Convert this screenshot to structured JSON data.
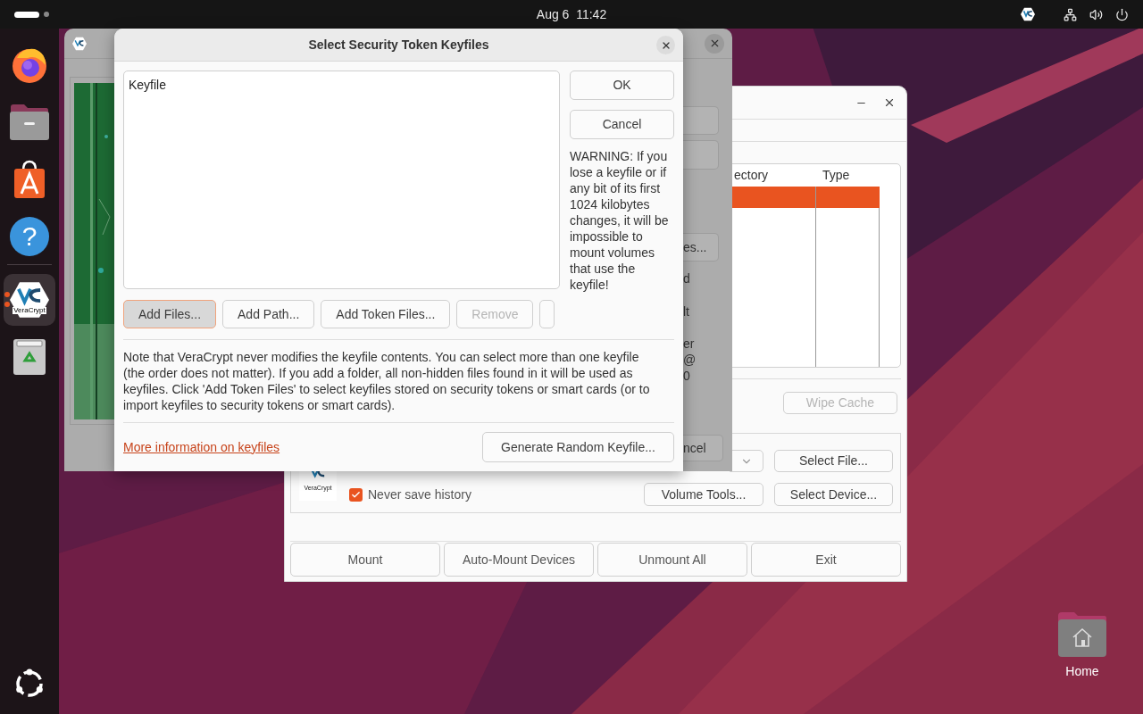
{
  "top_bar": {
    "clock": "Aug 6  11:42"
  },
  "dock": {
    "items": [
      {
        "kind": "firefox",
        "running": false
      },
      {
        "kind": "files",
        "running": false
      },
      {
        "kind": "appcenter",
        "running": false
      },
      {
        "kind": "help",
        "running": false,
        "glyph": "?"
      },
      {
        "kind": "veracrypt",
        "running": true,
        "logo_text": "VeraCrypt"
      },
      {
        "kind": "trash",
        "running": false
      }
    ]
  },
  "desktop_icons": [
    {
      "label": "Home"
    }
  ],
  "main_window": {
    "table": {
      "columns": [
        "ectory",
        "Type"
      ],
      "rows": [
        {
          "selected": true
        }
      ]
    },
    "wipe_cache": {
      "label": "Wipe Cache",
      "disabled": true
    },
    "logo_text": "VeraCrypt",
    "never_save_history": {
      "label": "Never save history",
      "checked": true
    },
    "select_file": "Select File...",
    "volume_tools": "Volume Tools...",
    "select_device": "Select Device...",
    "bottom_buttons": [
      "Mount",
      "Auto-Mount Devices",
      "Unmount All",
      "Exit"
    ]
  },
  "middle_window": {
    "button_fragment": "es...",
    "text_fragments": [
      "d",
      "lt",
      "er",
      "@",
      "0"
    ],
    "cancel_fragment": "ncel"
  },
  "dialog": {
    "title": "Select Security Token Keyfiles",
    "list": {
      "columns": [
        "Keyfile"
      ]
    },
    "side_buttons": [
      "OK",
      "Cancel"
    ],
    "warning": "WARNING: If you lose a keyfile or if any bit of its first 1024 kilobytes changes, it will be impossible to mount volumes that use the keyfile!",
    "list_buttons": [
      {
        "label": "Add Files...",
        "focused": true,
        "disabled": false
      },
      {
        "label": "Add Path...",
        "focused": false,
        "disabled": false
      },
      {
        "label": "Add Token Files...",
        "focused": false,
        "disabled": false
      },
      {
        "label": "Remove",
        "focused": false,
        "disabled": true
      }
    ],
    "note": "Note that VeraCrypt never modifies the keyfile contents. You can select more than one keyfile (the order does not matter). If you add a folder, all non-hidden files found in it will be used as keyfiles. Click 'Add Token Files' to select keyfiles stored on security tokens or smart cards (or to import keyfiles to security tokens or smart cards).",
    "link": "More information on keyfiles",
    "generate_button": "Generate Random Keyfile..."
  }
}
